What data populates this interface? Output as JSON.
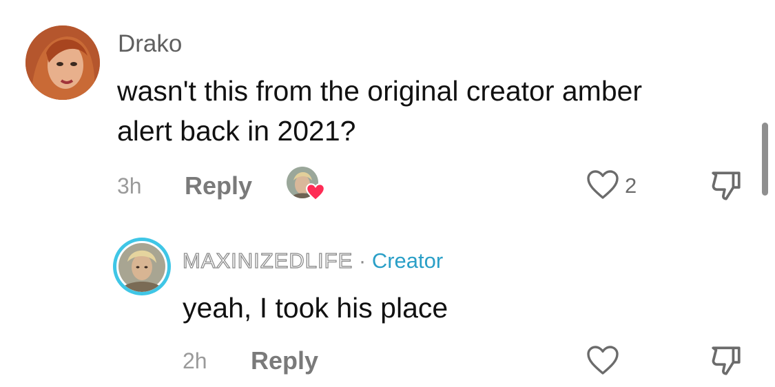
{
  "comments": [
    {
      "username": "Drako",
      "text_line1": "wasn't this from the original creator amber",
      "text_line2": "alert back in 2021?",
      "time": "3h",
      "reply_label": "Reply",
      "like_count": "2",
      "creator_liked": true
    },
    {
      "username": "MAXINIZEDLIFE",
      "separator": "·",
      "badge": "Creator",
      "text": "yeah, I took his place",
      "time": "2h",
      "reply_label": "Reply"
    }
  ],
  "colors": {
    "creator_badge": "#2a9fc7",
    "avatar_ring": "#3fc6e6",
    "liked_heart": "#fe2c55"
  }
}
